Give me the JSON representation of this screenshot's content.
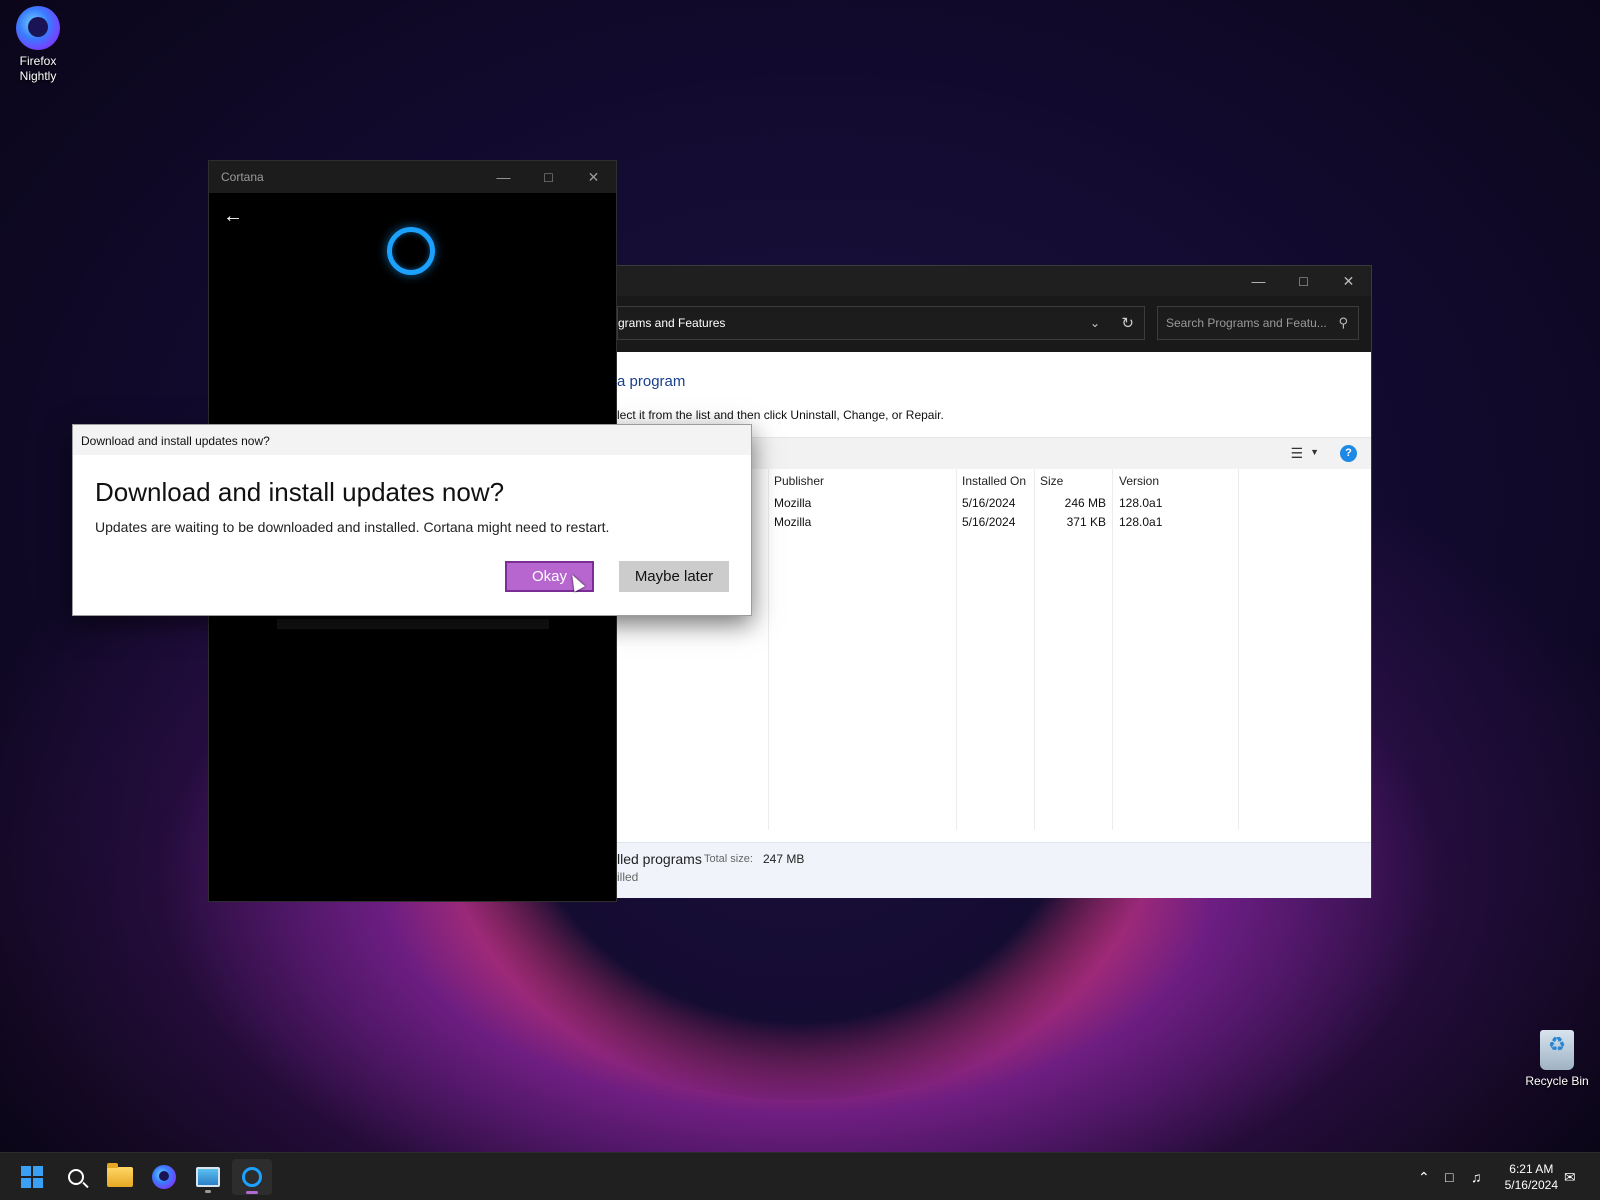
{
  "desktop": {
    "icons": [
      {
        "label": "Firefox\nNightly"
      },
      {
        "label": "Recycle Bin"
      }
    ]
  },
  "programs_window": {
    "address_crumb": "grams and Features",
    "search_placeholder": "Search Programs and Featu...",
    "heading": "a program",
    "instruction": "lect it from the list and then click Uninstall, Change, or Repair.",
    "columns": [
      "Publisher",
      "Installed On",
      "Size",
      "Version"
    ],
    "rows": [
      {
        "publisher": "Mozilla",
        "installed_on": "5/16/2024",
        "size": "246 MB",
        "version": "128.0a1"
      },
      {
        "publisher": "Mozilla",
        "installed_on": "5/16/2024",
        "size": "371 KB",
        "version": "128.0a1"
      }
    ],
    "footer": {
      "programs_label": "lled programs",
      "total_size_label": "Total size:",
      "total_size_value": "247 MB",
      "installed_label": "illed"
    }
  },
  "cortana_window": {
    "title": "Cortana"
  },
  "dialog": {
    "title": "Download and install updates now?",
    "heading": "Download and install updates now?",
    "message": "Updates are waiting to be downloaded and installed. Cortana might need to restart.",
    "okay_label": "Okay",
    "later_label": "Maybe later"
  },
  "taskbar": {
    "time": "6:21 AM",
    "date": "5/16/2024",
    "pinned": [
      "start-icon",
      "search-icon",
      "file-explorer-icon",
      "firefox-nightly-icon",
      "control-panel-icon",
      "cortana-icon"
    ]
  },
  "colors": {
    "okay_button": "#b765cf",
    "cortana_ring": "#1da1ff",
    "link_heading": "#1a3f8f"
  }
}
